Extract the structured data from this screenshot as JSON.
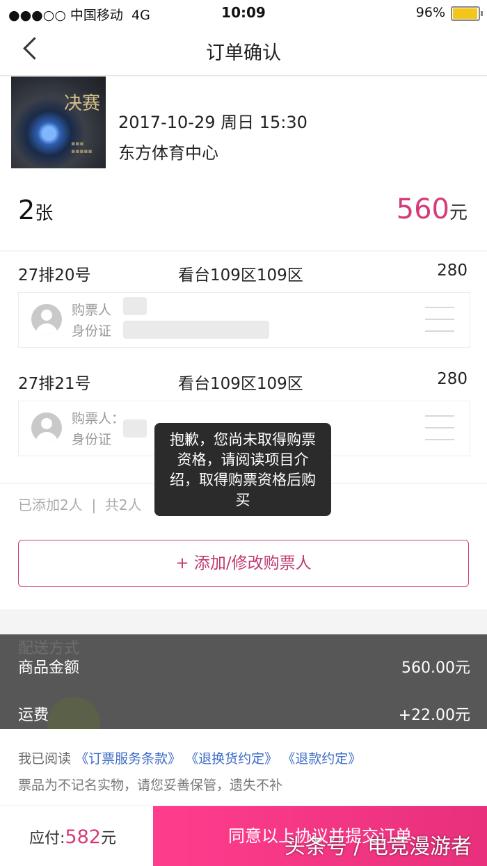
{
  "status_bar": {
    "carrier": "●●●○○ 中国移动",
    "network": "4G",
    "time": "10:09",
    "battery": "96%"
  },
  "nav": {
    "title": "订单确认"
  },
  "event": {
    "poster_text": "决赛",
    "datetime": "2017-10-29 周日 15:30",
    "venue": "东方体育中心",
    "quantity": "2",
    "quantity_unit": "张",
    "total": "560",
    "total_unit": "元"
  },
  "seats": [
    {
      "seat": "27排20号",
      "area": "看台109区109区",
      "price": "280",
      "buyer_label": "购票人",
      "id_label": "身份证"
    },
    {
      "seat": "27排21号",
      "area": "看台109区109区",
      "price": "280",
      "buyer_label": "购票人：",
      "id_label": "身份证"
    }
  ],
  "buyers": {
    "added": "已添加2人",
    "total": "共2人",
    "add_button": "+ 添加/修改购票人"
  },
  "toast": {
    "message": "抱歉，您尚未取得购票资格，请阅读项目介绍，取得购票资格后购买"
  },
  "summary": {
    "ghost_label": "配送方式",
    "goods_label": "商品金额",
    "goods_value": "560.00元",
    "shipping_label": "运费",
    "shipping_value": "+22.00元"
  },
  "agreement": {
    "prefix": "我已阅读",
    "links": [
      "《订票服务条款》",
      "《退换货约定》",
      "《退款约定》"
    ],
    "notice": "票品为不记名实物，请您妥善保管，遗失不补"
  },
  "footer": {
    "pay_label": "应付:",
    "pay_amount": "582",
    "pay_unit": "元",
    "submit_label": "同意以上协议并提交订单"
  },
  "watermark": "头条号 / 电竞漫游者",
  "colors": {
    "accent": "#d63a7a",
    "link": "#3a6bc7",
    "submit_bg": "#ff3d8d"
  }
}
